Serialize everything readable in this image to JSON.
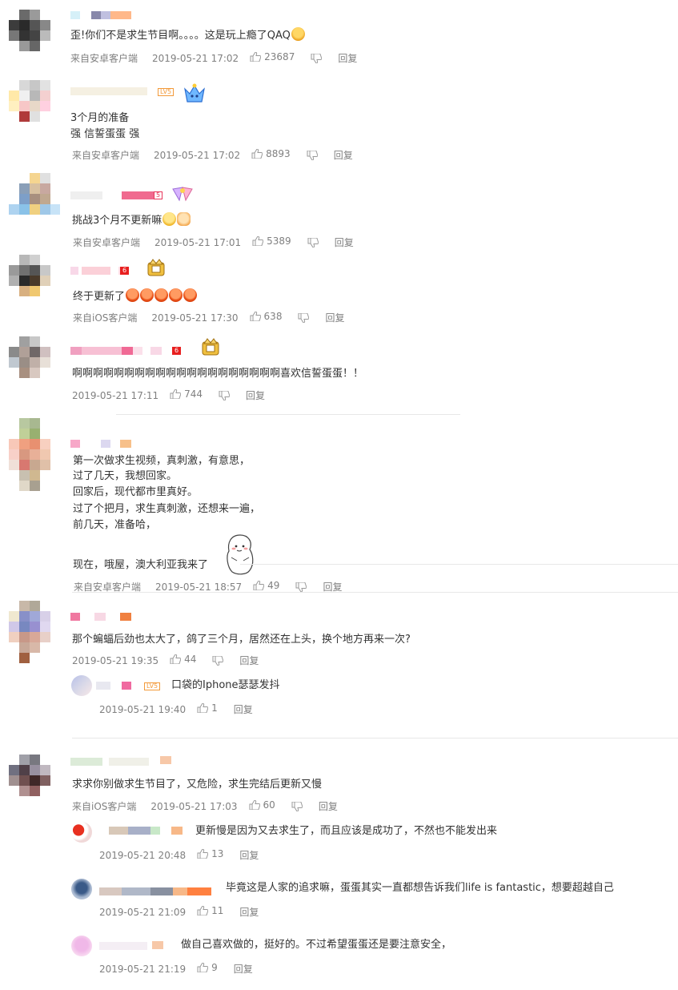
{
  "colors": {
    "meta_text": "#808080",
    "body_text": "#333333",
    "divider": "#e8e8e8",
    "badge": "#f39a3a"
  },
  "comments": [
    {
      "text": "歪!你们不是求生节目啊。。。。这是玩上瘾了QAQ",
      "emoji": "laugh-face-icon",
      "source": "来自安卓客户端",
      "time": "2019-05-21 17:02",
      "likes": "23687",
      "reply_label": "回复"
    },
    {
      "lines": [
        "3个月的准备",
        "强 信誓蛋蛋 强"
      ],
      "badge": "LV5",
      "source": "来自安卓客户端",
      "time": "2019-05-21 17:02",
      "likes": "8893",
      "reply_label": "回复"
    },
    {
      "text": "挑战3个月不更新嘛",
      "badge": "5",
      "source": "来自安卓客户端",
      "time": "2019-05-21 17:01",
      "likes": "5389",
      "reply_label": "回复"
    },
    {
      "text": "终于更新了",
      "badge": "6",
      "source": "来自iOS客户端",
      "time": "2019-05-21 17:30",
      "likes": "638",
      "reply_label": "回复"
    },
    {
      "text": "啊啊啊啊啊啊啊啊啊啊啊啊啊啊啊啊啊啊啊啊喜欢信誓蛋蛋！！",
      "badge": "6",
      "source": "",
      "time": "2019-05-21 17:11",
      "likes": "744",
      "reply_label": "回复"
    },
    {
      "lines": [
        "第一次做求生视频，真刺激，有意思，",
        "过了几天，我想回家。",
        "回家后，现代都市里真好。",
        "过了个把月，求生真刺激，还想来一遍，",
        "前几天，准备哈，",
        "",
        "现在，哦屋，澳大利亚我来了"
      ],
      "source": "来自安卓客户端",
      "time": "2019-05-21 18:57",
      "likes": "49",
      "reply_label": "回复"
    },
    {
      "text": "那个蝙蝠后劲也太大了，鸽了三个月，居然还在上头，换个地方再来一次?",
      "source": "",
      "time": "2019-05-21 19:35",
      "likes": "44",
      "reply_label": "回复",
      "replies": [
        {
          "badge": "LV5",
          "text": "口袋的Iphone瑟瑟发抖",
          "time": "2019-05-21 19:40",
          "likes": "1",
          "reply_label": "回复"
        }
      ]
    },
    {
      "text": "求求你别做求生节目了，又危险，求生完结后更新又慢",
      "source": "来自iOS客户端",
      "time": "2019-05-21 17:03",
      "likes": "60",
      "reply_label": "回复",
      "replies": [
        {
          "text": "更新慢是因为又去求生了，而且应该是成功了，不然也不能发出来",
          "time": "2019-05-21 20:48",
          "likes": "13",
          "reply_label": "回复"
        },
        {
          "text": "毕竟这是人家的追求嘛，蛋蛋其实一直都想告诉我们life is fantastic，想要超越自己",
          "time": "2019-05-21 21:09",
          "likes": "11",
          "reply_label": "回复"
        },
        {
          "text": "做自己喜欢做的，挺好的。不过希望蛋蛋还是要注意安全，",
          "time": "2019-05-21 21:19",
          "likes": "9",
          "reply_label": "回复"
        }
      ]
    }
  ]
}
